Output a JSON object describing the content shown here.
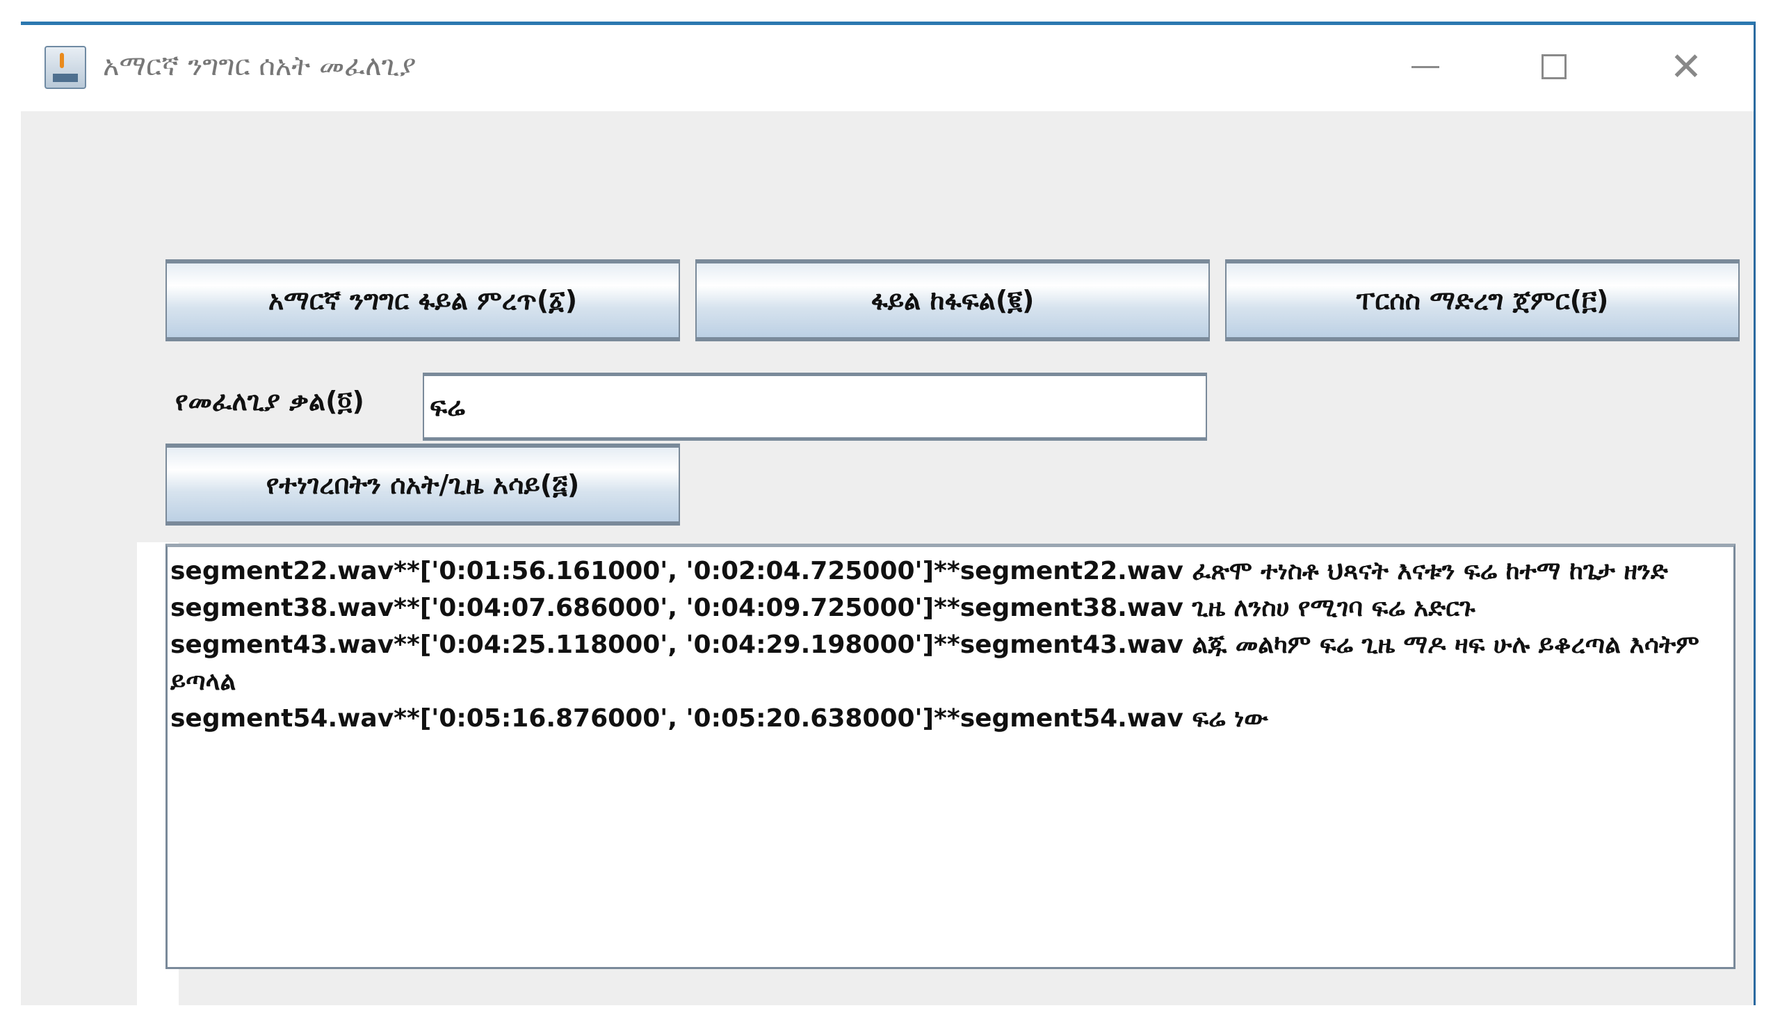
{
  "window": {
    "title": "አማርኛ ንግግር ሰአት መፈለጊያ",
    "controls": {
      "minimize": "minimize-icon",
      "maximize": "maximize-icon",
      "close": "close-icon"
    }
  },
  "buttons": {
    "choose_file": "አማርኛ ንግግር ፋይል ምረጥ(፩)",
    "split_file": "ፋይል ከፋፍል(፪)",
    "start_parsing": "ፐርሰስ ማድረግ ጀምር(፫)",
    "show_time": "የተነገረበትን ሰአት/ጊዜ አሳይ(፭)"
  },
  "search": {
    "label": "የመፈለጊያ ቃል(፬)",
    "value": "ፍሬ"
  },
  "results": [
    "segment22.wav**['0:01:56.161000', '0:02:04.725000']**segment22.wav   ፈጽሞ ተነስቶ ህጻናት እናቱን ፍሬ ከተማ ከጌታ ዘንድ",
    "segment38.wav**['0:04:07.686000', '0:04:09.725000']**segment38.wav   ጊዜ ለንስሀ የሚገባ ፍሬ አድርጉ",
    "segment43.wav**['0:04:25.118000', '0:04:29.198000']**segment43.wav   ልጁ መልካም ፍሬ ጊዜ ማዶ ዛፍ ሁሉ ይቆረጣል እሳትም ይጣላል",
    "segment54.wav**['0:05:16.876000', '0:05:20.638000']**segment54.wav   ፍሬ ነው"
  ]
}
